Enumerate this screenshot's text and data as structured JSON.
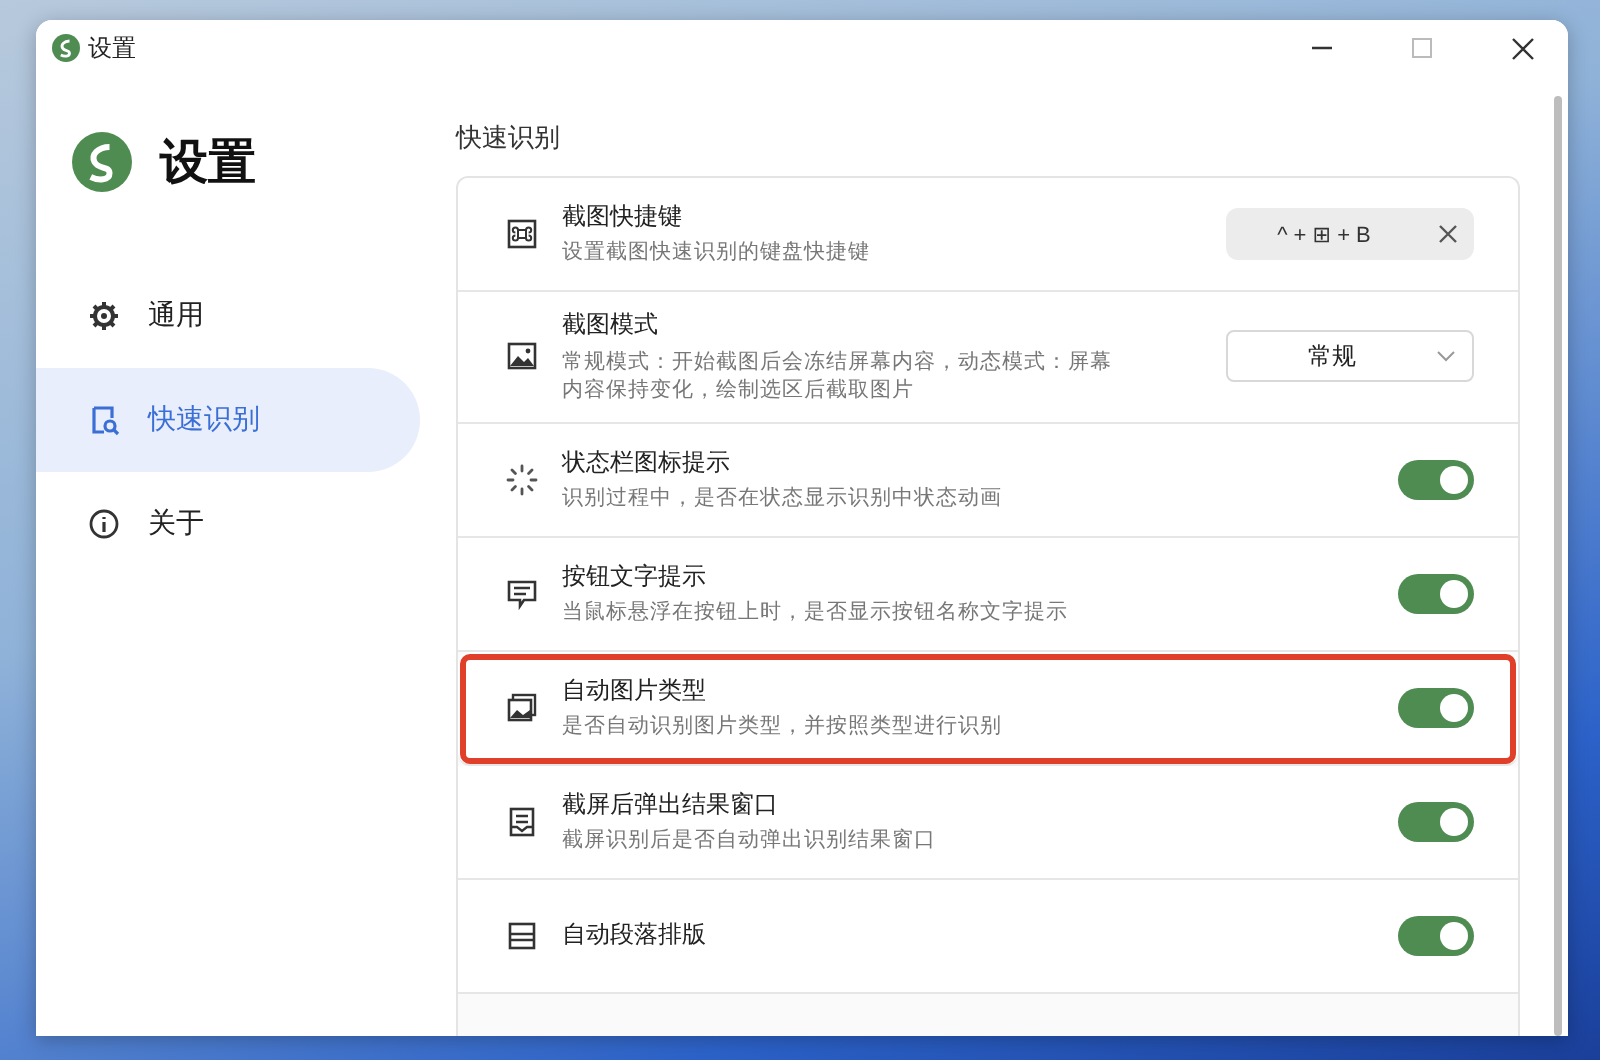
{
  "window": {
    "title": "设置"
  },
  "sidebar": {
    "title": "设置",
    "items": [
      {
        "label": "通用",
        "selected": false
      },
      {
        "label": "快速识别",
        "selected": true
      },
      {
        "label": "关于",
        "selected": false
      }
    ]
  },
  "section": {
    "title": "快速识别"
  },
  "rows": [
    {
      "kind": "shortcut",
      "title": "截图快捷键",
      "description": "设置截图快速识别的键盘快捷键",
      "value": "^ + ⊞ + B",
      "highlighted": false
    },
    {
      "kind": "dropdown",
      "title": "截图模式",
      "description": "常规模式：开始截图后会冻结屏幕内容，动态模式：屏幕内容保持变化，绘制选区后截取图片",
      "value": "常规",
      "highlighted": false
    },
    {
      "kind": "toggle",
      "title": "状态栏图标提示",
      "description": "识别过程中，是否在状态显示识别中状态动画",
      "on": true,
      "highlighted": false
    },
    {
      "kind": "toggle",
      "title": "按钮文字提示",
      "description": "当鼠标悬浮在按钮上时，是否显示按钮名称文字提示",
      "on": true,
      "highlighted": false
    },
    {
      "kind": "toggle",
      "title": "自动图片类型",
      "description": "是否自动识别图片类型，并按照类型进行识别",
      "on": true,
      "highlighted": true
    },
    {
      "kind": "toggle",
      "title": "截屏后弹出结果窗口",
      "description": "截屏识别后是否自动弹出识别结果窗口",
      "on": true,
      "highlighted": false
    },
    {
      "kind": "toggle",
      "title": "自动段落排版",
      "on": true,
      "highlighted": false
    }
  ]
}
